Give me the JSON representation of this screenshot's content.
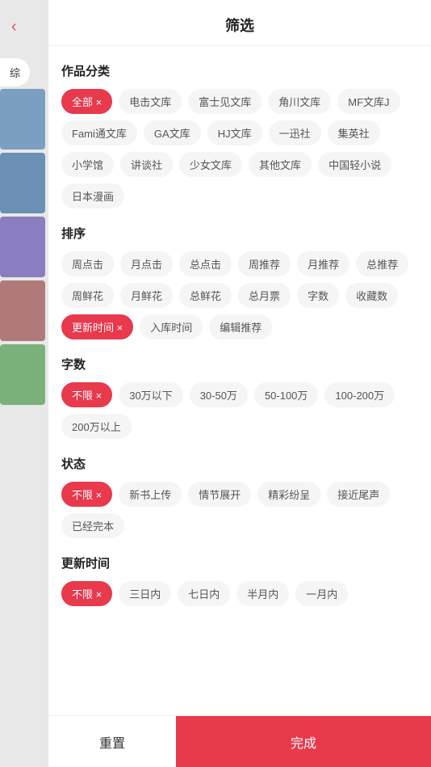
{
  "header": {
    "title": "筛选",
    "back_icon": "‹"
  },
  "sidebar": {
    "tab_label": "综",
    "back_icon": "‹"
  },
  "sections": {
    "category": {
      "title": "作品分类",
      "tags": [
        {
          "label": "全部",
          "active": true,
          "closable": true
        },
        {
          "label": "电击文库",
          "active": false
        },
        {
          "label": "富士见文库",
          "active": false
        },
        {
          "label": "角川文库",
          "active": false
        },
        {
          "label": "MF文库J",
          "active": false
        },
        {
          "label": "Fami通文库",
          "active": false
        },
        {
          "label": "GA文库",
          "active": false
        },
        {
          "label": "HJ文库",
          "active": false
        },
        {
          "label": "一迅社",
          "active": false
        },
        {
          "label": "集英社",
          "active": false
        },
        {
          "label": "小学馆",
          "active": false
        },
        {
          "label": "讲谈社",
          "active": false
        },
        {
          "label": "少女文库",
          "active": false
        },
        {
          "label": "其他文库",
          "active": false
        },
        {
          "label": "中国轻小说",
          "active": false
        },
        {
          "label": "日本漫画",
          "active": false
        }
      ]
    },
    "sort": {
      "title": "排序",
      "tags": [
        {
          "label": "周点击",
          "active": false
        },
        {
          "label": "月点击",
          "active": false
        },
        {
          "label": "总点击",
          "active": false
        },
        {
          "label": "周推荐",
          "active": false
        },
        {
          "label": "月推荐",
          "active": false
        },
        {
          "label": "总推荐",
          "active": false
        },
        {
          "label": "周鲜花",
          "active": false
        },
        {
          "label": "月鲜花",
          "active": false
        },
        {
          "label": "总鲜花",
          "active": false
        },
        {
          "label": "总月票",
          "active": false
        },
        {
          "label": "字数",
          "active": false
        },
        {
          "label": "收藏数",
          "active": false
        },
        {
          "label": "更新时间",
          "active": true,
          "closable": true
        },
        {
          "label": "入库时间",
          "active": false
        },
        {
          "label": "编辑推荐",
          "active": false
        }
      ]
    },
    "word_count": {
      "title": "字数",
      "tags": [
        {
          "label": "不限",
          "active": true,
          "closable": true
        },
        {
          "label": "30万以下",
          "active": false
        },
        {
          "label": "30-50万",
          "active": false
        },
        {
          "label": "50-100万",
          "active": false
        },
        {
          "label": "100-200万",
          "active": false
        },
        {
          "label": "200万以上",
          "active": false
        }
      ]
    },
    "status": {
      "title": "状态",
      "tags": [
        {
          "label": "不限",
          "active": true,
          "closable": true
        },
        {
          "label": "新书上传",
          "active": false
        },
        {
          "label": "情节展开",
          "active": false
        },
        {
          "label": "精彩纷呈",
          "active": false
        },
        {
          "label": "接近尾声",
          "active": false
        },
        {
          "label": "已经完本",
          "active": false
        }
      ]
    },
    "update_time": {
      "title": "更新时间",
      "tags": [
        {
          "label": "不限",
          "active": true,
          "closable": true
        },
        {
          "label": "三日内",
          "active": false
        },
        {
          "label": "七日内",
          "active": false
        },
        {
          "label": "半月内",
          "active": false
        },
        {
          "label": "一月内",
          "active": false
        }
      ]
    }
  },
  "footer": {
    "reset_label": "重置",
    "confirm_label": "完成"
  }
}
